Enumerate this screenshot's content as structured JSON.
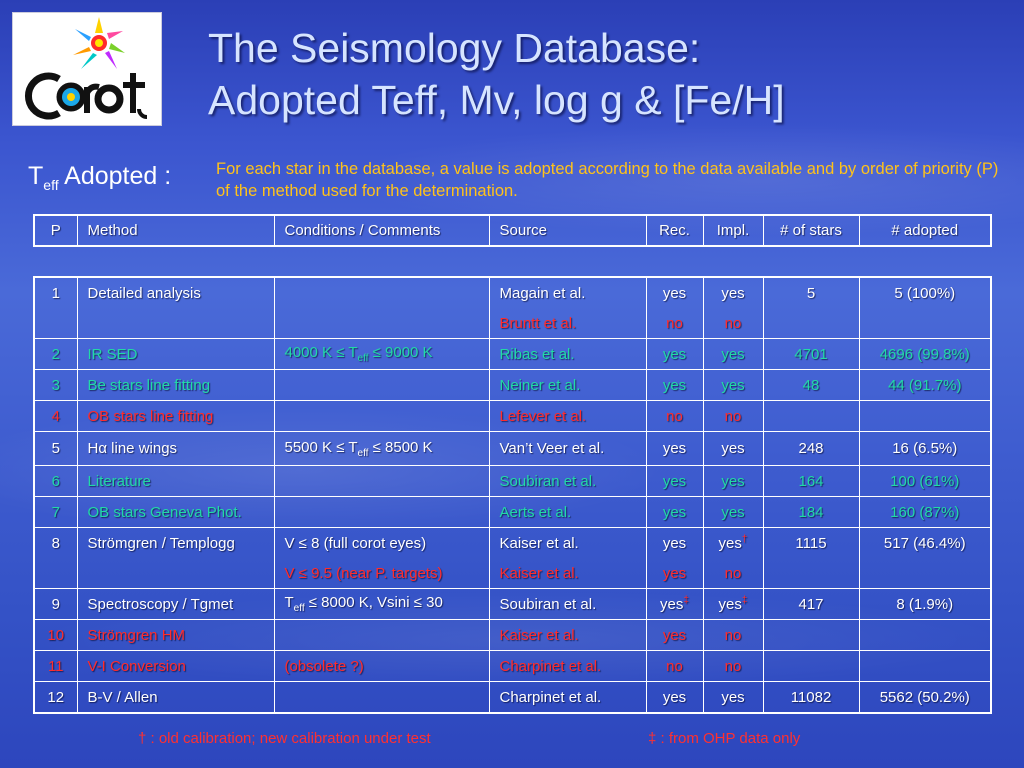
{
  "title": {
    "line1": "The Seismology Database:",
    "line2": "Adopted Teff, Mv, log g & [Fe/H]"
  },
  "logo": {
    "text": "Corot",
    "icon": "corot-logo"
  },
  "teff_label": {
    "main": "T",
    "sub": "eff",
    "rest": " Adopted :"
  },
  "intro": "For each star in the database, a value is adopted according to the data available and by order of priority (P) of the method used for the determination.",
  "headers": {
    "p": "P",
    "method": "Method",
    "conditions": "Conditions / Comments",
    "source": "Source",
    "rec": "Rec.",
    "impl": "Impl.",
    "nstars": "# of stars",
    "nadopted": "# adopted"
  },
  "rows": {
    "r1": {
      "p": "1",
      "method": "Detailed analysis",
      "source1": "Magain et al.",
      "rec1": "yes",
      "impl1": "yes",
      "nstars": "5",
      "nadopted": "5  (100%)",
      "source2": "Bruntt et al.",
      "rec2": "no",
      "impl2": "no"
    },
    "r2": {
      "p": "2",
      "method": "IR SED",
      "cond_a": "4000 K ≤ T",
      "cond_sub": "eff",
      "cond_b": " ≤ 9000 K",
      "source": "Ribas et al.",
      "rec": "yes",
      "impl": "yes",
      "nstars": "4701",
      "nadopted": "4696 (99.8%)"
    },
    "r3": {
      "p": "3",
      "method": "Be stars line fitting",
      "source": "Neiner et al.",
      "rec": "yes",
      "impl": "yes",
      "nstars": "48",
      "nadopted": "44 (91.7%)"
    },
    "r4": {
      "p": "4",
      "method": "OB stars line fitting",
      "source": "Lefever et al.",
      "rec": "no",
      "impl": "no"
    },
    "r5": {
      "p": "5",
      "method": "Hα line wings",
      "cond_a": "5500 K ≤ T",
      "cond_sub": "eff",
      "cond_b": " ≤ 8500 K",
      "source": "Van’t Veer et al.",
      "rec": "yes",
      "impl": "yes",
      "nstars": "248",
      "nadopted": "16 (6.5%)"
    },
    "r6": {
      "p": "6",
      "method": "Literature",
      "source": "Soubiran et al.",
      "rec": "yes",
      "impl": "yes",
      "nstars": "164",
      "nadopted": "100 (61%)"
    },
    "r7": {
      "p": "7",
      "method": "OB stars Geneva Phot.",
      "source": "Aerts et al.",
      "rec": "yes",
      "impl": "yes",
      "nstars": "184",
      "nadopted": "160 (87%)"
    },
    "r8": {
      "p": "8",
      "method": "Strömgren / Templogg",
      "cond1": "V ≤ 8 (full corot eyes)",
      "source1": "Kaiser et al.",
      "rec1": "yes",
      "impl1": "yes",
      "impl1_mark": "†",
      "nstars": "1115",
      "nadopted": "517 (46.4%)",
      "cond2": "V ≤ 9.5 (near P. targets)",
      "source2": "Kaiser et al.",
      "rec2": "yes",
      "impl2": "no"
    },
    "r9": {
      "p": "9",
      "method": "Spectroscopy / Tgmet",
      "cond_a": "T",
      "cond_sub": "eff",
      "cond_b": " ≤ 8000 K, Vsini ≤ 30",
      "source": "Soubiran et al.",
      "rec": "yes",
      "rec_mark": "‡",
      "impl": "yes",
      "impl_mark": "‡",
      "nstars": "417",
      "nadopted": "8 (1.9%)"
    },
    "r10": {
      "p": "10",
      "method": "Strömgren HM",
      "source": "Kaiser et al.",
      "rec": "yes",
      "impl": "no"
    },
    "r11": {
      "p": "11",
      "method": "V-I Conversion",
      "cond": "(obsolete ?)",
      "source": "Charpinet et al.",
      "rec": "no",
      "impl": "no"
    },
    "r12": {
      "p": "12",
      "method": "B-V / Allen",
      "source": "Charpinet et al.",
      "rec": "yes",
      "impl": "yes",
      "nstars": "11082",
      "nadopted": "5562 (50.2%)"
    }
  },
  "footnotes": {
    "dagger": "† : old calibration; new calibration under test",
    "ddagger": "‡ : from OHP data only"
  },
  "colors": {
    "white": "#ffffff",
    "green": "#22d9a6",
    "red": "#ff2c2c",
    "intro": "#ffc21a"
  }
}
